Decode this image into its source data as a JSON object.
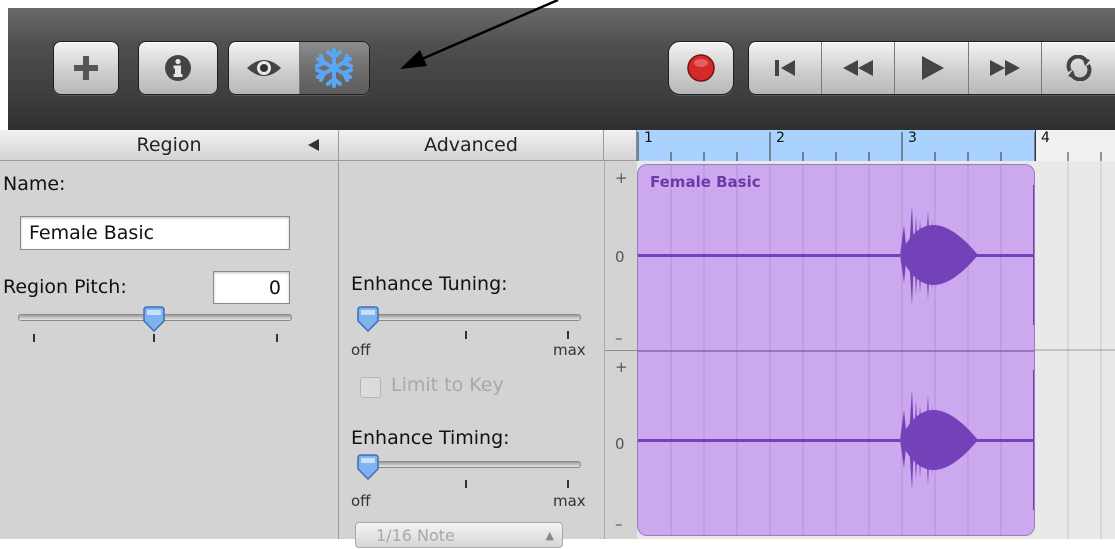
{
  "toolbar": {
    "left_buttons": [
      "add-icon",
      "info-icon",
      "eye-icon",
      "snowflake-icon"
    ],
    "transport": [
      "record-icon",
      "go-to-start-icon",
      "rewind-icon",
      "play-icon",
      "fast-forward-icon",
      "cycle-icon"
    ],
    "record_color": "#d62a2a",
    "active_color": "#5a9bf0"
  },
  "region_panel": {
    "header": "Region",
    "name_label": "Name:",
    "name_value": "Female Basic",
    "pitch_label": "Region Pitch:",
    "pitch_value": "0"
  },
  "advanced_panel": {
    "header": "Advanced",
    "tuning_label": "Enhance Tuning:",
    "off_label": "off",
    "max_label": "max",
    "limit_label": "Limit to Key",
    "timing_label": "Enhance Timing:",
    "note_value": "1/16 Note"
  },
  "scale": {
    "plus": "+",
    "zero": "0",
    "minus": "–"
  },
  "ruler": {
    "marks": [
      "1",
      "2",
      "3",
      "4"
    ],
    "bar_color": "#a9d2ff"
  },
  "region": {
    "title": "Female Basic",
    "color": "#cca8ee",
    "wave_color": "#7442b8"
  }
}
